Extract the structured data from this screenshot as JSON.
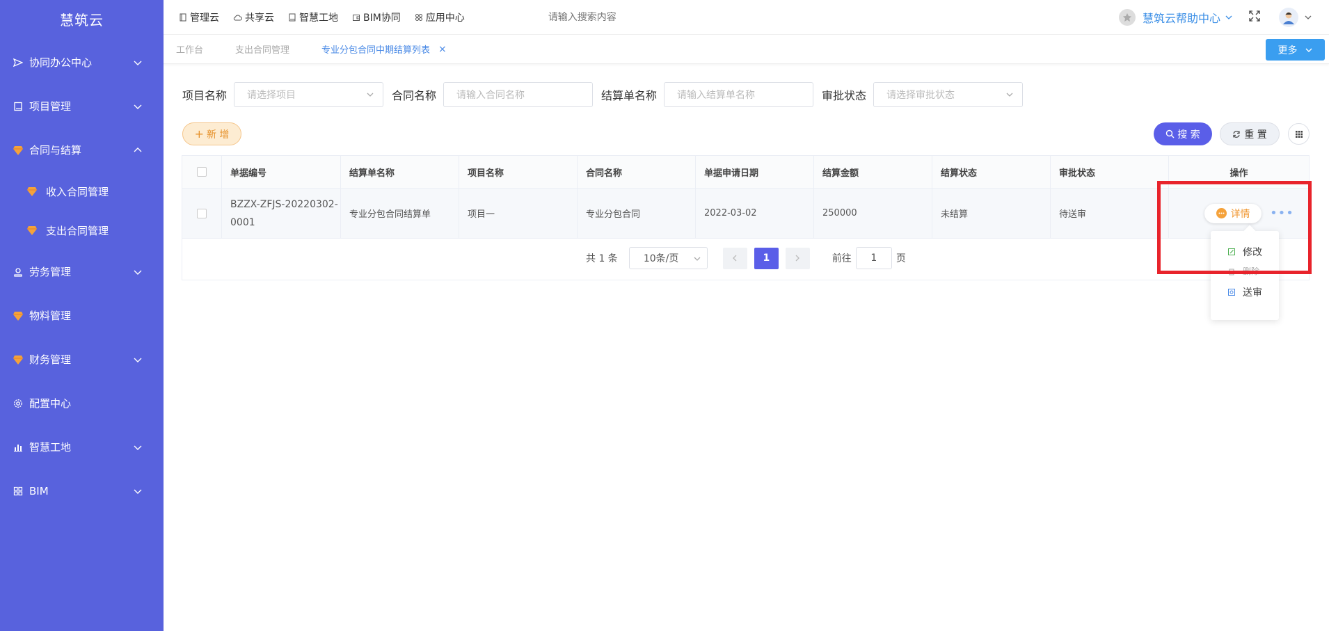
{
  "app": {
    "logo": "慧筑云"
  },
  "sidebar": {
    "items": [
      {
        "label": "协同办公中心",
        "icon": "send-icon",
        "expandable": true
      },
      {
        "label": "项目管理",
        "icon": "book-icon",
        "expandable": true
      },
      {
        "label": "合同与结算",
        "icon": "gem-icon",
        "expanded": true
      },
      {
        "label": "收入合同管理",
        "icon": "gem-icon",
        "sub": true
      },
      {
        "label": "支出合同管理",
        "icon": "gem-icon",
        "sub": true
      },
      {
        "label": "劳务管理",
        "icon": "worker-icon",
        "expandable": true
      },
      {
        "label": "物料管理",
        "icon": "gem-icon"
      },
      {
        "label": "财务管理",
        "icon": "gem-icon",
        "expandable": true
      },
      {
        "label": "配置中心",
        "icon": "gear-icon"
      },
      {
        "label": "智慧工地",
        "icon": "bar-chart-icon",
        "expandable": true
      },
      {
        "label": "BIM",
        "icon": "grid-icon",
        "expandable": true
      }
    ]
  },
  "topbar": {
    "links": [
      "管理云",
      "共享云",
      "智慧工地",
      "BIM协同",
      "应用中心"
    ],
    "search_placeholder": "请输入搜索内容",
    "help": "慧筑云帮助中心"
  },
  "tabs": {
    "items": [
      "工作台",
      "支出合同管理",
      "专业分包合同中期结算列表"
    ],
    "active_index": 2,
    "more": "更多"
  },
  "filters": {
    "project_label": "项目名称",
    "project_placeholder": "请选择项目",
    "contract_label": "合同名称",
    "contract_placeholder": "请输入合同名称",
    "settle_label": "结算单名称",
    "settle_placeholder": "请输入结算单名称",
    "approval_label": "审批状态",
    "approval_placeholder": "请选择审批状态"
  },
  "actions": {
    "add": "新 增",
    "search": "搜 索",
    "reset": "重 置"
  },
  "table": {
    "headers": [
      "单据编号",
      "结算单名称",
      "项目名称",
      "合同名称",
      "单据申请日期",
      "结算金额",
      "结算状态",
      "审批状态",
      "操作"
    ],
    "rows": [
      {
        "code_line1": "BZZX-ZFJS-20220302-",
        "code_line2": "0001",
        "name": "专业分包合同结算单",
        "project": "项目一",
        "contract": "专业分包合同",
        "date": "2022-03-02",
        "amount": "250000",
        "settle_status": "未结算",
        "approval_status": "待送审",
        "detail": "详情",
        "more": "•••"
      }
    ]
  },
  "pagination": {
    "total": "共 1 条",
    "page_size": "10条/页",
    "current": "1",
    "goto_prefix": "前往",
    "goto_value": "1",
    "goto_suffix": "页"
  },
  "dropdown": {
    "edit": "修改",
    "delete": "删除",
    "send": "送审"
  },
  "colors": {
    "sidebar": "#5862dd",
    "primary": "#5a5ee8",
    "accent": "#f0962e",
    "highlight": "#e8232b"
  }
}
